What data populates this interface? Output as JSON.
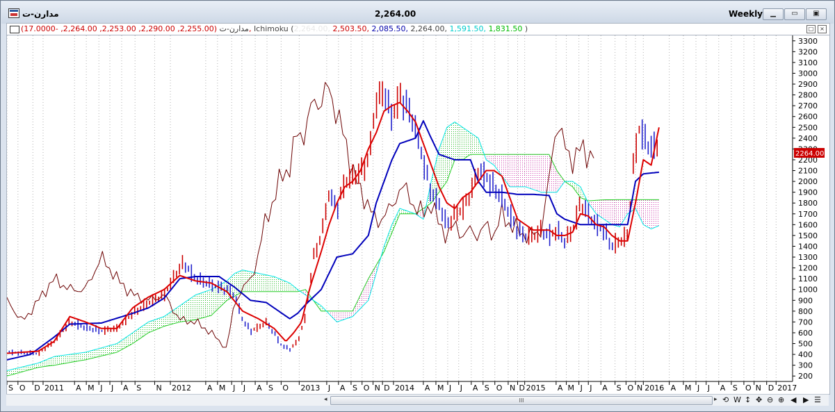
{
  "window": {
    "symbol": "مدارن-ت",
    "price": "2,264.00",
    "period": "Weekly",
    "buttons": [
      "minimize",
      "maximize",
      "close"
    ]
  },
  "legend": {
    "symbol": "مدارن-ت",
    "ohlc": "(2,255.00, 2,290.00, 2,253.00, 2,264.00, -17.0000),",
    "indicator": "Ichimoku",
    "values": [
      {
        "text": "2,264.00",
        "color": "#e8e8e8"
      },
      {
        "text": "2,503.50",
        "color": "#cc0000"
      },
      {
        "text": "2,085.50",
        "color": "#0000aa"
      },
      {
        "text": "2,264.00",
        "color": "#444444"
      },
      {
        "text": "1,591.50",
        "color": "#00cccc"
      },
      {
        "text": "1,831.50",
        "color": "#00bb00"
      }
    ],
    "close_paren": ")"
  },
  "scrollbar": {
    "thumb_label": "III"
  },
  "toolbar_icons": [
    "refresh-icon",
    "w-icon",
    "vertical-resize-icon",
    "move-icon",
    "zoom-out-icon",
    "zoom-in-icon",
    "scroll-left-icon",
    "scroll-right-icon",
    "menu-icon"
  ],
  "toolbar_labels": [
    "⟲",
    "W",
    "↕",
    "✥",
    "⊖",
    "⊕",
    "◀",
    "▶",
    "☰"
  ],
  "chart_data": {
    "type": "line",
    "yticks": [
      200,
      300,
      400,
      500,
      600,
      700,
      800,
      900,
      1000,
      1100,
      1200,
      1300,
      1400,
      1500,
      1600,
      1700,
      1800,
      1900,
      2000,
      2100,
      2200,
      2300,
      2400,
      2500,
      2600,
      2700,
      2800,
      2900,
      3000,
      3100,
      3200,
      3300
    ],
    "ylim": [
      150,
      3350
    ],
    "x_range": [
      0,
      100
    ],
    "last_price_label": "2264.00",
    "xticks": [
      {
        "x": 0.0,
        "label": "S"
      },
      {
        "x": 1.4,
        "label": "O"
      },
      {
        "x": 3.3,
        "label": "D"
      },
      {
        "x": 4.6,
        "label": "2011"
      },
      {
        "x": 8.6,
        "label": "A"
      },
      {
        "x": 10.1,
        "label": "M"
      },
      {
        "x": 11.7,
        "label": "J"
      },
      {
        "x": 13.1,
        "label": "J"
      },
      {
        "x": 14.6,
        "label": "A"
      },
      {
        "x": 16.3,
        "label": "S"
      },
      {
        "x": 18.8,
        "label": "N"
      },
      {
        "x": 20.8,
        "label": "2012"
      },
      {
        "x": 25.3,
        "label": "A"
      },
      {
        "x": 26.8,
        "label": "M"
      },
      {
        "x": 28.6,
        "label": "J"
      },
      {
        "x": 29.9,
        "label": "J"
      },
      {
        "x": 31.6,
        "label": "A"
      },
      {
        "x": 33.1,
        "label": "S"
      },
      {
        "x": 34.9,
        "label": "O"
      },
      {
        "x": 37.2,
        "label": "2013"
      },
      {
        "x": 40.7,
        "label": "J"
      },
      {
        "x": 42.2,
        "label": "A"
      },
      {
        "x": 43.8,
        "label": "S"
      },
      {
        "x": 45.2,
        "label": "O"
      },
      {
        "x": 46.6,
        "label": "N"
      },
      {
        "x": 47.8,
        "label": "D"
      },
      {
        "x": 49.2,
        "label": "2014"
      },
      {
        "x": 53.0,
        "label": "A"
      },
      {
        "x": 54.6,
        "label": "M"
      },
      {
        "x": 56.1,
        "label": "J"
      },
      {
        "x": 57.5,
        "label": "J"
      },
      {
        "x": 59.1,
        "label": "A"
      },
      {
        "x": 60.6,
        "label": "S"
      },
      {
        "x": 62.1,
        "label": "O"
      },
      {
        "x": 63.8,
        "label": "N"
      },
      {
        "x": 65.0,
        "label": "D"
      },
      {
        "x": 65.9,
        "label": "2015"
      },
      {
        "x": 69.9,
        "label": "A"
      },
      {
        "x": 71.2,
        "label": "M"
      },
      {
        "x": 72.8,
        "label": "J"
      },
      {
        "x": 74.0,
        "label": "J"
      },
      {
        "x": 75.6,
        "label": "A"
      },
      {
        "x": 77.4,
        "label": "S"
      },
      {
        "x": 78.8,
        "label": "O"
      },
      {
        "x": 80.0,
        "label": "N"
      },
      {
        "x": 81.0,
        "label": "2016"
      },
      {
        "x": 84.3,
        "label": "A"
      },
      {
        "x": 86.1,
        "label": "M"
      },
      {
        "x": 87.7,
        "label": "J"
      },
      {
        "x": 89.0,
        "label": "J"
      },
      {
        "x": 90.6,
        "label": "A"
      },
      {
        "x": 92.2,
        "label": "S"
      },
      {
        "x": 93.8,
        "label": "O"
      },
      {
        "x": 95.1,
        "label": "N"
      },
      {
        "x": 96.7,
        "label": "D"
      },
      {
        "x": 97.9,
        "label": "2017"
      }
    ],
    "colors": {
      "bars": "#cc0000",
      "bars_down": "#2222cc",
      "tenkan": "#dd0000",
      "kijun": "#0000bb",
      "chikou": "#6b0000",
      "spanA": "#00e5e5",
      "spanB": "#22cc22",
      "cloud_bull": "#22bb22",
      "cloud_bear": "#cc33aa",
      "grid": "#b0b0b0"
    },
    "price_key": [
      [
        0,
        420
      ],
      [
        4,
        410
      ],
      [
        6,
        520
      ],
      [
        8,
        700
      ],
      [
        10,
        650
      ],
      [
        12,
        620
      ],
      [
        14,
        640
      ],
      [
        16,
        780
      ],
      [
        18,
        880
      ],
      [
        20,
        950
      ],
      [
        21.5,
        1150
      ],
      [
        22.5,
        1250
      ],
      [
        24,
        1100
      ],
      [
        26,
        1050
      ],
      [
        28,
        1000
      ],
      [
        29,
        950
      ],
      [
        30,
        720
      ],
      [
        31,
        620
      ],
      [
        32,
        650
      ],
      [
        33,
        700
      ],
      [
        34,
        600
      ],
      [
        35,
        480
      ],
      [
        36,
        450
      ],
      [
        37,
        520
      ],
      [
        38,
        750
      ],
      [
        39,
        1300
      ],
      [
        40,
        1500
      ],
      [
        41,
        1900
      ],
      [
        42,
        1750
      ],
      [
        43,
        2000
      ],
      [
        44,
        2050
      ],
      [
        45,
        2100
      ],
      [
        46,
        2200
      ],
      [
        47,
        2750
      ],
      [
        48,
        2850
      ],
      [
        49,
        2600
      ],
      [
        50,
        2800
      ],
      [
        51,
        2700
      ],
      [
        52,
        2500
      ],
      [
        53,
        2200
      ],
      [
        54,
        1900
      ],
      [
        55,
        1800
      ],
      [
        56,
        1600
      ],
      [
        57,
        1700
      ],
      [
        58,
        1750
      ],
      [
        59,
        1900
      ],
      [
        60,
        2100
      ],
      [
        61,
        2050
      ],
      [
        62,
        1950
      ],
      [
        63,
        1850
      ],
      [
        64,
        1700
      ],
      [
        65,
        1550
      ],
      [
        66,
        1500
      ],
      [
        67,
        1500
      ],
      [
        68,
        1550
      ],
      [
        69,
        1500
      ],
      [
        70,
        1550
      ],
      [
        71,
        1450
      ],
      [
        72,
        1550
      ],
      [
        73,
        1800
      ],
      [
        74,
        1700
      ],
      [
        75,
        1600
      ],
      [
        76,
        1550
      ],
      [
        77,
        1400
      ],
      [
        78,
        1450
      ],
      [
        79,
        1500
      ],
      [
        79.8,
        2200
      ],
      [
        80.5,
        2500
      ],
      [
        81.5,
        2350
      ],
      [
        82.5,
        2300
      ],
      [
        83,
        2400
      ]
    ],
    "tenkan_key": [
      [
        0,
        410
      ],
      [
        4,
        430
      ],
      [
        6,
        520
      ],
      [
        8,
        750
      ],
      [
        10,
        700
      ],
      [
        12,
        640
      ],
      [
        14,
        640
      ],
      [
        16,
        830
      ],
      [
        18,
        930
      ],
      [
        20,
        1000
      ],
      [
        22,
        1130
      ],
      [
        24,
        1080
      ],
      [
        26,
        1060
      ],
      [
        28,
        980
      ],
      [
        30,
        800
      ],
      [
        32,
        730
      ],
      [
        34,
        640
      ],
      [
        35.5,
        520
      ],
      [
        36.5,
        600
      ],
      [
        37.5,
        700
      ],
      [
        38.5,
        1000
      ],
      [
        40,
        1350
      ],
      [
        41,
        1600
      ],
      [
        42,
        1800
      ],
      [
        43,
        1950
      ],
      [
        44,
        2000
      ],
      [
        45,
        2100
      ],
      [
        46,
        2300
      ],
      [
        47,
        2450
      ],
      [
        48,
        2650
      ],
      [
        49,
        2700
      ],
      [
        50,
        2730
      ],
      [
        51,
        2650
      ],
      [
        52,
        2550
      ],
      [
        53,
        2350
      ],
      [
        54,
        2150
      ],
      [
        55,
        1950
      ],
      [
        56,
        1800
      ],
      [
        57,
        1750
      ],
      [
        58,
        1850
      ],
      [
        59,
        1900
      ],
      [
        60,
        2000
      ],
      [
        61,
        2100
      ],
      [
        62,
        2100
      ],
      [
        63,
        2050
      ],
      [
        64,
        1850
      ],
      [
        65,
        1650
      ],
      [
        66,
        1600
      ],
      [
        67,
        1550
      ],
      [
        68,
        1550
      ],
      [
        69,
        1550
      ],
      [
        70,
        1500
      ],
      [
        71,
        1500
      ],
      [
        72,
        1530
      ],
      [
        73,
        1700
      ],
      [
        74,
        1680
      ],
      [
        75,
        1600
      ],
      [
        76,
        1580
      ],
      [
        77,
        1500
      ],
      [
        78,
        1450
      ],
      [
        79,
        1450
      ],
      [
        80,
        1800
      ],
      [
        81,
        2200
      ],
      [
        82,
        2150
      ],
      [
        83,
        2500
      ]
    ],
    "kijun_key": [
      [
        0,
        350
      ],
      [
        3,
        400
      ],
      [
        6,
        560
      ],
      [
        8,
        680
      ],
      [
        12,
        690
      ],
      [
        16,
        780
      ],
      [
        18,
        830
      ],
      [
        20,
        920
      ],
      [
        22,
        1100
      ],
      [
        24,
        1120
      ],
      [
        27,
        1120
      ],
      [
        29,
        1020
      ],
      [
        31,
        900
      ],
      [
        33,
        880
      ],
      [
        35,
        780
      ],
      [
        36,
        730
      ],
      [
        37,
        780
      ],
      [
        38,
        860
      ],
      [
        40,
        1000
      ],
      [
        42,
        1300
      ],
      [
        44,
        1330
      ],
      [
        46,
        1500
      ],
      [
        47,
        1800
      ],
      [
        48,
        2000
      ],
      [
        49,
        2200
      ],
      [
        50,
        2350
      ],
      [
        52,
        2400
      ],
      [
        53,
        2560
      ],
      [
        54,
        2400
      ],
      [
        55,
        2250
      ],
      [
        57,
        2200
      ],
      [
        59,
        2200
      ],
      [
        60,
        2000
      ],
      [
        61,
        1900
      ],
      [
        63,
        1900
      ],
      [
        65,
        1880
      ],
      [
        67,
        1880
      ],
      [
        69,
        1870
      ],
      [
        70,
        1700
      ],
      [
        71,
        1650
      ],
      [
        73,
        1600
      ],
      [
        75,
        1600
      ],
      [
        77,
        1600
      ],
      [
        79,
        1600
      ],
      [
        80,
        2000
      ],
      [
        81,
        2070
      ],
      [
        83,
        2085
      ]
    ],
    "chikou_key": [
      [
        0,
        900
      ],
      [
        2,
        700
      ],
      [
        4,
        900
      ],
      [
        6,
        1100
      ],
      [
        8,
        1000
      ],
      [
        10,
        1000
      ],
      [
        12,
        1300
      ],
      [
        14,
        1100
      ],
      [
        16,
        950
      ],
      [
        18,
        900
      ],
      [
        20,
        950
      ],
      [
        22,
        720
      ],
      [
        24,
        700
      ],
      [
        26,
        600
      ],
      [
        28,
        450
      ],
      [
        29,
        900
      ],
      [
        30,
        1000
      ],
      [
        31,
        1100
      ],
      [
        32,
        1300
      ],
      [
        33,
        1700
      ],
      [
        34,
        1800
      ],
      [
        35,
        2100
      ],
      [
        36,
        2100
      ],
      [
        37,
        2500
      ],
      [
        38,
        2400
      ],
      [
        39,
        2800
      ],
      [
        40,
        2700
      ],
      [
        41,
        2900
      ],
      [
        42,
        2600
      ],
      [
        43,
        2400
      ],
      [
        44,
        2100
      ],
      [
        45,
        1900
      ],
      [
        46,
        1800
      ],
      [
        47,
        1600
      ],
      [
        48,
        1700
      ],
      [
        49,
        1750
      ],
      [
        50,
        1950
      ],
      [
        51,
        1900
      ],
      [
        52,
        1750
      ],
      [
        53,
        1700
      ],
      [
        54,
        1800
      ],
      [
        55,
        1600
      ],
      [
        56,
        1500
      ],
      [
        57,
        1600
      ],
      [
        58,
        1500
      ],
      [
        59,
        1550
      ],
      [
        60,
        1500
      ],
      [
        61,
        1600
      ],
      [
        62,
        1500
      ],
      [
        63,
        1700
      ],
      [
        64,
        1600
      ],
      [
        65,
        1550
      ],
      [
        66,
        1500
      ],
      [
        67,
        1500
      ],
      [
        68,
        1550
      ],
      [
        69,
        2000
      ],
      [
        70,
        2600
      ],
      [
        71,
        2300
      ],
      [
        72,
        2200
      ],
      [
        73,
        2300
      ],
      [
        74,
        2250
      ],
      [
        75,
        2250
      ]
    ],
    "spanA_key": [
      [
        0,
        250
      ],
      [
        4,
        320
      ],
      [
        6,
        380
      ],
      [
        10,
        420
      ],
      [
        14,
        500
      ],
      [
        16,
        600
      ],
      [
        18,
        700
      ],
      [
        20,
        750
      ],
      [
        22,
        850
      ],
      [
        24,
        950
      ],
      [
        26,
        1000
      ],
      [
        28,
        1080
      ],
      [
        29,
        1150
      ],
      [
        30,
        1180
      ],
      [
        32,
        1150
      ],
      [
        34,
        1120
      ],
      [
        36,
        1060
      ],
      [
        37,
        1000
      ],
      [
        38,
        950
      ],
      [
        40,
        850
      ],
      [
        42,
        700
      ],
      [
        44,
        750
      ],
      [
        46,
        900
      ],
      [
        48,
        1400
      ],
      [
        49,
        1600
      ],
      [
        50,
        1750
      ],
      [
        52,
        1700
      ],
      [
        53,
        1650
      ],
      [
        54,
        2000
      ],
      [
        55,
        2300
      ],
      [
        56,
        2500
      ],
      [
        57,
        2550
      ],
      [
        58,
        2500
      ],
      [
        59,
        2450
      ],
      [
        60,
        2400
      ],
      [
        61,
        2200
      ],
      [
        62,
        2150
      ],
      [
        63,
        2050
      ],
      [
        64,
        1950
      ],
      [
        66,
        1950
      ],
      [
        68,
        1900
      ],
      [
        70,
        1900
      ],
      [
        71,
        2000
      ],
      [
        72,
        2000
      ],
      [
        73,
        1950
      ],
      [
        74,
        1800
      ],
      [
        75,
        1700
      ],
      [
        76,
        1650
      ],
      [
        77,
        1600
      ],
      [
        78,
        1580
      ],
      [
        79,
        1700
      ],
      [
        80,
        1750
      ],
      [
        81,
        1600
      ],
      [
        82,
        1560
      ],
      [
        83,
        1591
      ]
    ],
    "spanB_key": [
      [
        0,
        200
      ],
      [
        4,
        280
      ],
      [
        6,
        300
      ],
      [
        10,
        350
      ],
      [
        14,
        420
      ],
      [
        16,
        500
      ],
      [
        18,
        600
      ],
      [
        20,
        660
      ],
      [
        22,
        700
      ],
      [
        24,
        720
      ],
      [
        26,
        760
      ],
      [
        28,
        900
      ],
      [
        30,
        980
      ],
      [
        32,
        980
      ],
      [
        34,
        980
      ],
      [
        36,
        980
      ],
      [
        37,
        980
      ],
      [
        38,
        1000
      ],
      [
        40,
        800
      ],
      [
        42,
        800
      ],
      [
        44,
        800
      ],
      [
        46,
        1100
      ],
      [
        48,
        1350
      ],
      [
        50,
        1700
      ],
      [
        52,
        1700
      ],
      [
        54,
        1800
      ],
      [
        56,
        2000
      ],
      [
        57,
        2200
      ],
      [
        58,
        2200
      ],
      [
        59,
        2250
      ],
      [
        60,
        2250
      ],
      [
        62,
        2250
      ],
      [
        64,
        2250
      ],
      [
        66,
        2250
      ],
      [
        68,
        2250
      ],
      [
        69,
        2250
      ],
      [
        70,
        2100
      ],
      [
        71,
        2000
      ],
      [
        72,
        1950
      ],
      [
        73,
        1850
      ],
      [
        74,
        1820
      ],
      [
        76,
        1830
      ],
      [
        78,
        1831
      ],
      [
        80,
        1831
      ],
      [
        82,
        1831
      ],
      [
        83,
        1831
      ]
    ]
  }
}
